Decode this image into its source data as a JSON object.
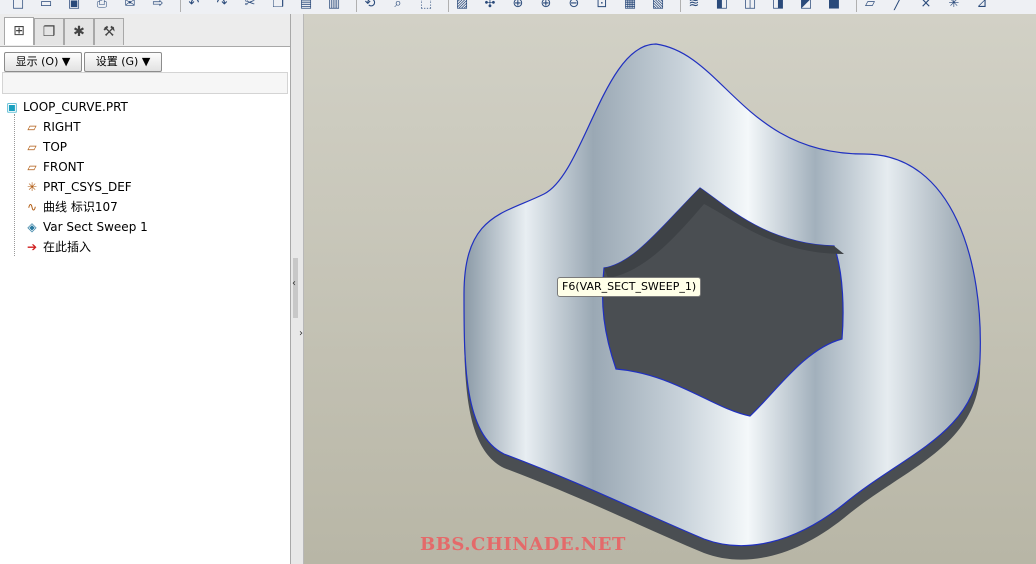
{
  "toolbar": {
    "icons": [
      "new-icon",
      "open-icon",
      "save-icon",
      "print-icon",
      "mail-icon",
      "send-icon",
      "undo-icon",
      "redo-icon",
      "cut-icon",
      "copy-icon",
      "paste-icon",
      "paste-special-icon",
      "regenerate-icon",
      "find-icon",
      "select-box-icon",
      "repaint-icon",
      "spin-center-icon",
      "orient-icon",
      "zoom-in-icon",
      "zoom-out-icon",
      "refit-icon",
      "view-manager-icon",
      "saved-views-icon",
      "layers-icon",
      "shading-icon",
      "wireframe-icon",
      "hidden-line-icon",
      "no-hidden-icon",
      "shaded-icon",
      "datum-plane-icon",
      "datum-axis-icon",
      "datum-point-icon",
      "csys-icon",
      "annotation-icon"
    ]
  },
  "left_panel": {
    "tabs": [
      "model-tree",
      "layers",
      "favorites",
      "tools"
    ],
    "show_button": "显示 (O) ▼",
    "settings_button": "设置 (G) ▼",
    "tree": [
      {
        "label": "LOOP_CURVE.PRT",
        "icon": "part-icon"
      },
      {
        "label": "RIGHT",
        "icon": "datum-plane-icon"
      },
      {
        "label": "TOP",
        "icon": "datum-plane-icon"
      },
      {
        "label": "FRONT",
        "icon": "datum-plane-icon"
      },
      {
        "label": "PRT_CSYS_DEF",
        "icon": "csys-icon"
      },
      {
        "label": "曲线 标识107",
        "icon": "curve-icon"
      },
      {
        "label": "Var Sect Sweep 1",
        "icon": "sweep-feature-icon"
      },
      {
        "label": "在此插入",
        "icon": "insert-arrow-icon"
      }
    ]
  },
  "viewport": {
    "tooltip": "F6(VAR_SECT_SWEEP_1)",
    "watermark": "BBS.CHINADE.NET"
  }
}
